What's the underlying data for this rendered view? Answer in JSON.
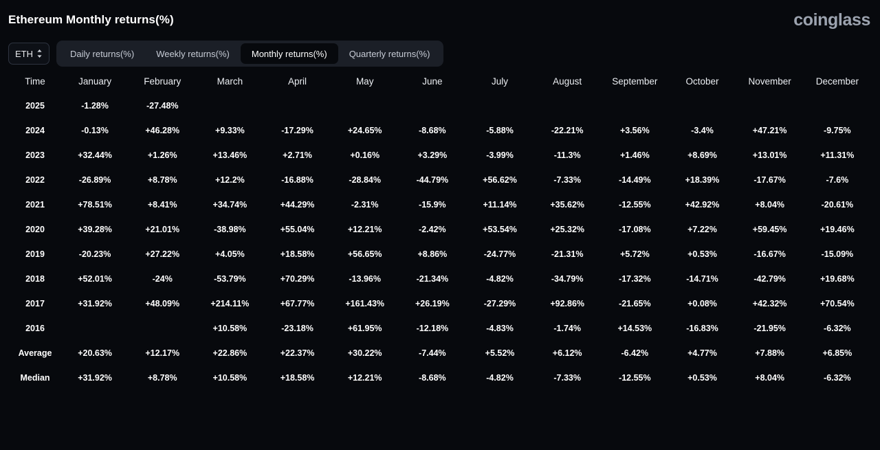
{
  "header": {
    "title": "Ethereum Monthly returns(%)",
    "brand": "coinglass"
  },
  "controls": {
    "symbol": "ETH",
    "symbol_icon": "chevron-up-down-icon",
    "tabs": [
      {
        "label": "Daily returns(%)",
        "active": false
      },
      {
        "label": "Weekly returns(%)",
        "active": false
      },
      {
        "label": "Monthly returns(%)",
        "active": true
      },
      {
        "label": "Quarterly returns(%)",
        "active": false
      }
    ]
  },
  "colors": {
    "positive": "#4ecb8d",
    "negative": "#f97f7f",
    "stat": "#6d6d6d",
    "background": "#07090d",
    "brand": "#9ca3af"
  },
  "chart_data": {
    "type": "heatmap",
    "title": "Ethereum Monthly returns(%)",
    "xlabel": "",
    "ylabel": "Time",
    "columns": [
      "Time",
      "January",
      "February",
      "March",
      "April",
      "May",
      "June",
      "July",
      "August",
      "September",
      "October",
      "November",
      "December"
    ],
    "categories": [
      "January",
      "February",
      "March",
      "April",
      "May",
      "June",
      "July",
      "August",
      "September",
      "October",
      "November",
      "December"
    ],
    "rows": [
      {
        "label": "2025",
        "kind": "year",
        "cells": [
          "-1.28%",
          "-27.48%",
          "",
          "",
          "",
          "",
          "",
          "",
          "",
          "",
          "",
          ""
        ],
        "values": [
          -1.28,
          -27.48,
          null,
          null,
          null,
          null,
          null,
          null,
          null,
          null,
          null,
          null
        ]
      },
      {
        "label": "2024",
        "kind": "year",
        "cells": [
          "-0.13%",
          "+46.28%",
          "+9.33%",
          "-17.29%",
          "+24.65%",
          "-8.68%",
          "-5.88%",
          "-22.21%",
          "+3.56%",
          "-3.4%",
          "+47.21%",
          "-9.75%"
        ],
        "values": [
          -0.13,
          46.28,
          9.33,
          -17.29,
          24.65,
          -8.68,
          -5.88,
          -22.21,
          3.56,
          -3.4,
          47.21,
          -9.75
        ]
      },
      {
        "label": "2023",
        "kind": "year",
        "cells": [
          "+32.44%",
          "+1.26%",
          "+13.46%",
          "+2.71%",
          "+0.16%",
          "+3.29%",
          "-3.99%",
          "-11.3%",
          "+1.46%",
          "+8.69%",
          "+13.01%",
          "+11.31%"
        ],
        "values": [
          32.44,
          1.26,
          13.46,
          2.71,
          0.16,
          3.29,
          -3.99,
          -11.3,
          1.46,
          8.69,
          13.01,
          11.31
        ]
      },
      {
        "label": "2022",
        "kind": "year",
        "cells": [
          "-26.89%",
          "+8.78%",
          "+12.2%",
          "-16.88%",
          "-28.84%",
          "-44.79%",
          "+56.62%",
          "-7.33%",
          "-14.49%",
          "+18.39%",
          "-17.67%",
          "-7.6%"
        ],
        "values": [
          -26.89,
          8.78,
          12.2,
          -16.88,
          -28.84,
          -44.79,
          56.62,
          -7.33,
          -14.49,
          18.39,
          -17.67,
          -7.6
        ]
      },
      {
        "label": "2021",
        "kind": "year",
        "cells": [
          "+78.51%",
          "+8.41%",
          "+34.74%",
          "+44.29%",
          "-2.31%",
          "-15.9%",
          "+11.14%",
          "+35.62%",
          "-12.55%",
          "+42.92%",
          "+8.04%",
          "-20.61%"
        ],
        "values": [
          78.51,
          8.41,
          34.74,
          44.29,
          -2.31,
          -15.9,
          11.14,
          35.62,
          -12.55,
          42.92,
          8.04,
          -20.61
        ]
      },
      {
        "label": "2020",
        "kind": "year",
        "cells": [
          "+39.28%",
          "+21.01%",
          "-38.98%",
          "+55.04%",
          "+12.21%",
          "-2.42%",
          "+53.54%",
          "+25.32%",
          "-17.08%",
          "+7.22%",
          "+59.45%",
          "+19.46%"
        ],
        "values": [
          39.28,
          21.01,
          -38.98,
          55.04,
          12.21,
          -2.42,
          53.54,
          25.32,
          -17.08,
          7.22,
          59.45,
          19.46
        ]
      },
      {
        "label": "2019",
        "kind": "year",
        "cells": [
          "-20.23%",
          "+27.22%",
          "+4.05%",
          "+18.58%",
          "+56.65%",
          "+8.86%",
          "-24.77%",
          "-21.31%",
          "+5.72%",
          "+0.53%",
          "-16.67%",
          "-15.09%"
        ],
        "values": [
          -20.23,
          27.22,
          4.05,
          18.58,
          56.65,
          8.86,
          -24.77,
          -21.31,
          5.72,
          0.53,
          -16.67,
          -15.09
        ]
      },
      {
        "label": "2018",
        "kind": "year",
        "cells": [
          "+52.01%",
          "-24%",
          "-53.79%",
          "+70.29%",
          "-13.96%",
          "-21.34%",
          "-4.82%",
          "-34.79%",
          "-17.32%",
          "-14.71%",
          "-42.79%",
          "+19.68%"
        ],
        "values": [
          52.01,
          -24,
          -53.79,
          70.29,
          -13.96,
          -21.34,
          -4.82,
          -34.79,
          -17.32,
          -14.71,
          -42.79,
          19.68
        ]
      },
      {
        "label": "2017",
        "kind": "year",
        "cells": [
          "+31.92%",
          "+48.09%",
          "+214.11%",
          "+67.77%",
          "+161.43%",
          "+26.19%",
          "-27.29%",
          "+92.86%",
          "-21.65%",
          "+0.08%",
          "+42.32%",
          "+70.54%"
        ],
        "values": [
          31.92,
          48.09,
          214.11,
          67.77,
          161.43,
          26.19,
          -27.29,
          92.86,
          -21.65,
          0.08,
          42.32,
          70.54
        ]
      },
      {
        "label": "2016",
        "kind": "year",
        "cells": [
          "",
          "",
          "+10.58%",
          "-23.18%",
          "+61.95%",
          "-12.18%",
          "-4.83%",
          "-1.74%",
          "+14.53%",
          "-16.83%",
          "-21.95%",
          "-6.32%"
        ],
        "values": [
          null,
          null,
          10.58,
          -23.18,
          61.95,
          -12.18,
          -4.83,
          -1.74,
          14.53,
          -16.83,
          -21.95,
          -6.32
        ]
      },
      {
        "label": "Average",
        "kind": "stat",
        "cells": [
          "+20.63%",
          "+12.17%",
          "+22.86%",
          "+22.37%",
          "+30.22%",
          "-7.44%",
          "+5.52%",
          "+6.12%",
          "-6.42%",
          "+4.77%",
          "+7.88%",
          "+6.85%"
        ],
        "values": [
          20.63,
          12.17,
          22.86,
          22.37,
          30.22,
          -7.44,
          5.52,
          6.12,
          -6.42,
          4.77,
          7.88,
          6.85
        ]
      },
      {
        "label": "Median",
        "kind": "stat",
        "cells": [
          "+31.92%",
          "+8.78%",
          "+10.58%",
          "+18.58%",
          "+12.21%",
          "-8.68%",
          "-4.82%",
          "-7.33%",
          "-12.55%",
          "+0.53%",
          "+8.04%",
          "-6.32%"
        ],
        "values": [
          31.92,
          8.78,
          10.58,
          18.58,
          12.21,
          -8.68,
          -4.82,
          -7.33,
          -12.55,
          0.53,
          8.04,
          -6.32
        ]
      }
    ]
  }
}
